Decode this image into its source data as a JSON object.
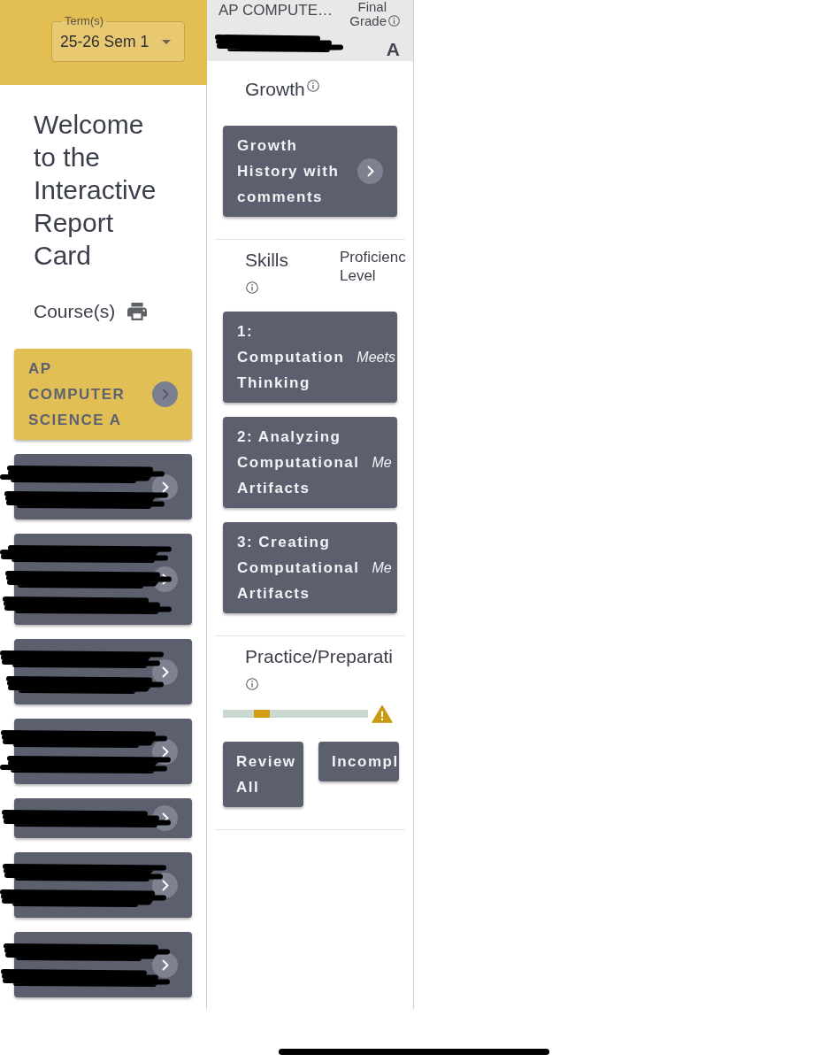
{
  "term_select": {
    "label": "Term(s)",
    "value": "25-26 Sem 1"
  },
  "welcome_title": "Welcome to the Interactive Report Card",
  "courses": {
    "heading": "Course(s)",
    "items": [
      {
        "kind": "text",
        "name": "AP COMPUTER SCIENCE A",
        "selected": true,
        "redacted": false
      },
      {
        "kind": "medium",
        "selected": false,
        "redacted": true
      },
      {
        "kind": "tall",
        "selected": false,
        "redacted": true
      },
      {
        "kind": "medium",
        "selected": false,
        "redacted": true
      },
      {
        "kind": "medium",
        "selected": false,
        "redacted": true
      },
      {
        "kind": "short",
        "selected": false,
        "redacted": true
      },
      {
        "kind": "medium",
        "selected": false,
        "redacted": true
      },
      {
        "kind": "medium",
        "selected": false,
        "redacted": true
      }
    ]
  },
  "course_detail": {
    "header": {
      "course": "AP COMPUTE…",
      "subtitle_redacted": true,
      "final_grade_label": "Final Grade",
      "final_grade": "A"
    },
    "growth": {
      "title": "Growth",
      "button": "Growth History with comments"
    },
    "skills": {
      "title": "Skills",
      "level_heading": "Proficienc Level",
      "items": [
        {
          "name": "1: Computation Thinking",
          "proficiency": "Meets"
        },
        {
          "name": "2: Analyzing Computational Artifacts",
          "proficiency": "Me"
        },
        {
          "name": "3: Creating Computational Artifacts",
          "proficiency": "Me"
        }
      ]
    },
    "practice": {
      "title": "Practice/Preparati",
      "level": 0.27,
      "warning": true,
      "buttons": [
        "Review All",
        "Incompl"
      ]
    }
  }
}
